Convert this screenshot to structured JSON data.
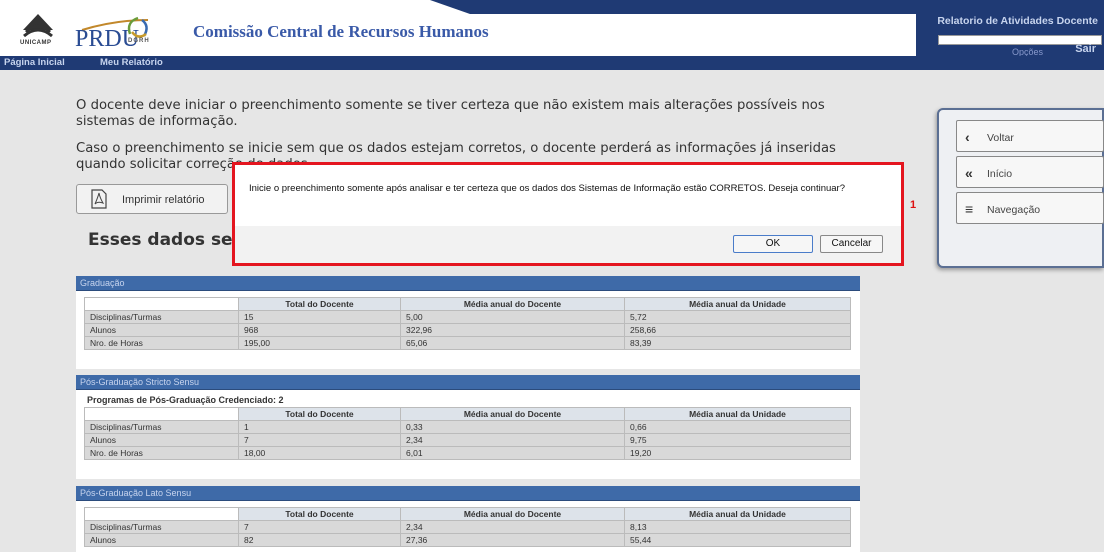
{
  "header": {
    "unicamp_text": "UNICAMP",
    "prdu_text": "PRDU",
    "dgrh_text": "DGRH",
    "title": "Comissão Central de Recursos Humanos",
    "system_title": "Relatorio de Atividades Docente",
    "options_label": "Opções",
    "logout_label": "Sair"
  },
  "nav": {
    "home": "Página Inicial",
    "report": "Meu Relatório"
  },
  "content": {
    "para1": "O docente deve iniciar o preenchimento somente se tiver certeza que não existem mais alterações possíveis nos sistemas de informação.",
    "para2": "Caso o preenchimento se inicie sem que os dados estejam corretos, o docente perderá as informações já inseridas quando solicitar correção de dados.",
    "print_button": "Imprimir relatório",
    "heading": "Esses dados serão"
  },
  "tables": {
    "graduacao": {
      "title": "Graduação",
      "headers": [
        "",
        "Total do Docente",
        "Média anual do Docente",
        "Média anual da Unidade"
      ],
      "rows": [
        [
          "Disciplinas/Turmas",
          "15",
          "5,00",
          "5,72"
        ],
        [
          "Alunos",
          "968",
          "322,96",
          "258,66"
        ],
        [
          "Nro. de Horas",
          "195,00",
          "65,06",
          "83,39"
        ]
      ]
    },
    "stricto": {
      "title": "Pós-Graduação Stricto Sensu",
      "programs_label": "Programas de Pós-Graduação Credenciado:  2",
      "headers": [
        "",
        "Total do Docente",
        "Média anual do Docente",
        "Média anual da Unidade"
      ],
      "rows": [
        [
          "Disciplinas/Turmas",
          "1",
          "0,33",
          "0,66"
        ],
        [
          "Alunos",
          "7",
          "2,34",
          "9,75"
        ],
        [
          "Nro. de Horas",
          "18,00",
          "6,01",
          "19,20"
        ]
      ]
    },
    "lato": {
      "title": "Pós-Graduação Lato Sensu",
      "headers": [
        "",
        "Total do Docente",
        "Média anual do Docente",
        "Média anual da Unidade"
      ],
      "rows": [
        [
          "Disciplinas/Turmas",
          "7",
          "2,34",
          "8,13"
        ],
        [
          "Alunos",
          "82",
          "27,36",
          "55,44"
        ]
      ]
    }
  },
  "side_panel": {
    "back": "Voltar",
    "start": "Início",
    "navigation": "Navegação"
  },
  "modal": {
    "message": "Inicie o preenchimento somente após analisar e ter certeza que os dados dos Sistemas de Informação estão CORRETOS. Deseja continuar?",
    "ok": "OK",
    "cancel": "Cancelar",
    "marker": "1"
  },
  "colors": {
    "nav_bg": "#1f3a74",
    "section_header": "#3e6aa8",
    "modal_border": "#e4151f"
  },
  "icons": [
    "unicamp-logo-icon",
    "dgrh-logo-icon",
    "pdf-icon",
    "chevron-left-icon",
    "double-chevron-left-icon",
    "menu-icon"
  ]
}
